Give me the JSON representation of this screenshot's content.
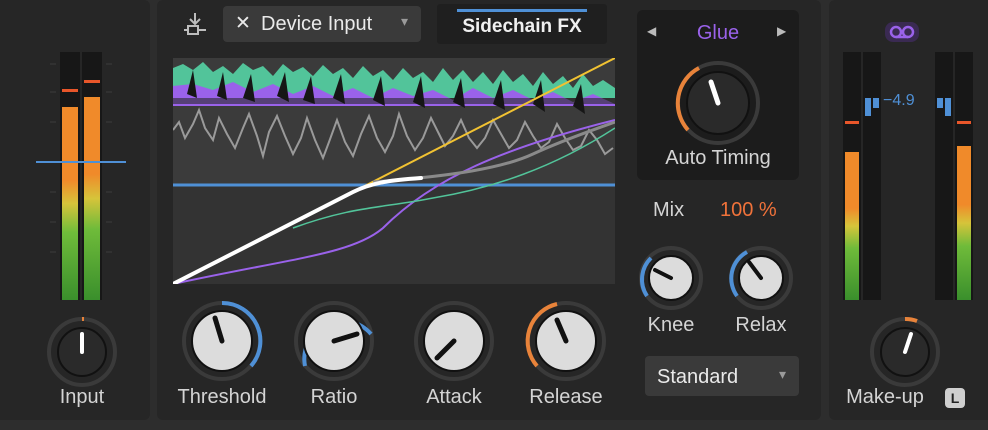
{
  "colors": {
    "accent_blue": "#4f90d6",
    "accent_orange": "#e8833a",
    "accent_purple": "#9a62ea",
    "green_fill": "#52c49a",
    "value_orange": "#f0723a",
    "panel_bg": "#262626"
  },
  "input_section": {
    "knob_label": "Input"
  },
  "header": {
    "routing_icon": "sidechain-routing-icon",
    "device_input_close_glyph": "✕",
    "device_input_label": "Device Input",
    "device_input_arrow": "▾",
    "sidechain_fx_label": "Sidechain FX"
  },
  "knobs": {
    "threshold": {
      "label": "Threshold",
      "level": 0.45
    },
    "ratio": {
      "label": "Ratio",
      "level": 0.6
    },
    "attack": {
      "label": "Attack",
      "level": 0.15
    },
    "release": {
      "label": "Release",
      "level": 0.3
    }
  },
  "character_panel": {
    "prev_arrow": "◀",
    "next_arrow": "▶",
    "preset": "Glue",
    "auto_timing_label": "Auto Timing"
  },
  "mix": {
    "label": "Mix",
    "value": "100 %"
  },
  "small_knobs": {
    "knee": {
      "label": "Knee"
    },
    "relax": {
      "label": "Relax"
    }
  },
  "mode_select": {
    "value": "Standard",
    "arrow": "▾"
  },
  "output_section": {
    "link_icon": "stereo-link-icon",
    "gain_reduction_readout": "−4.9",
    "knob_label": "Make-up",
    "l_badge": "L"
  }
}
